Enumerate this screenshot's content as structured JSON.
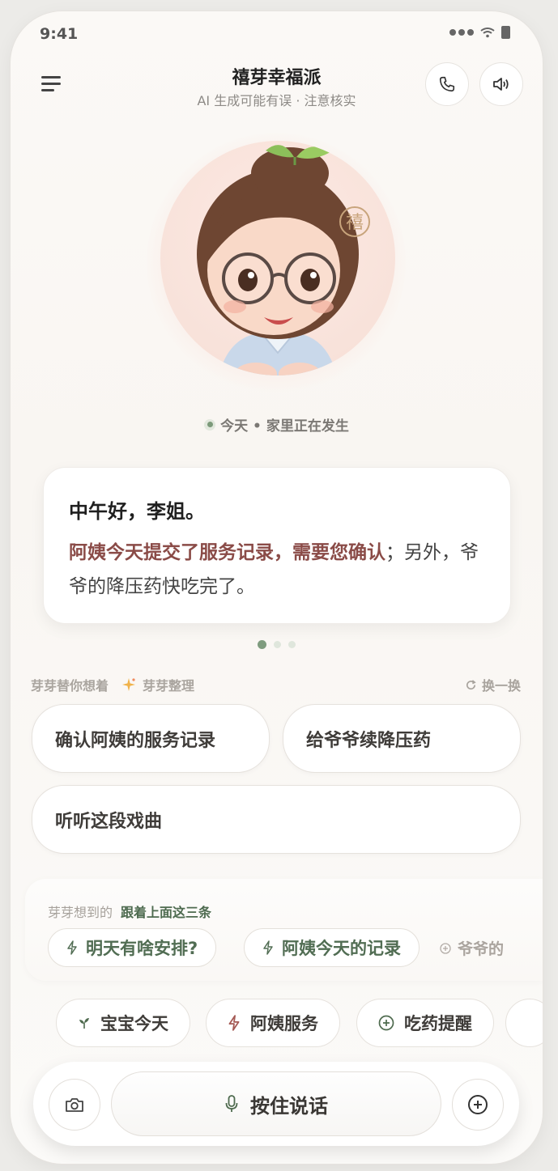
{
  "status": {
    "time": "9:41"
  },
  "header": {
    "title": "禧芽幸福派",
    "subtitle": "AI 生成可能有误 · 注意核实"
  },
  "avatar": {
    "badge_char": "禧"
  },
  "today": {
    "label": "今天 • 家里正在发生"
  },
  "greeting_card": {
    "title": "中午好，李姐。",
    "highlight": "阿姨今天提交了服务记录，需要您确认",
    "rest": "；另外，爷爷的降压药快吃完了。"
  },
  "pager": {
    "count": 3,
    "active": 1
  },
  "suggestions": {
    "head_left": "芽芽替你想着",
    "head_tag": "芽芽整理",
    "refresh": "换一换",
    "items": [
      "确认阿姨的服务记录",
      "给爷爷续降压药",
      "听听这段戏曲"
    ]
  },
  "related": {
    "label": "芽芽想到的",
    "label_strong": "跟着上面这三条",
    "chips": [
      "明天有啥安排?",
      "阿姨今天的记录",
      "爷爷的"
    ]
  },
  "quick_actions": [
    "宝宝今天",
    "阿姨服务",
    "吃药提醒"
  ],
  "input_bar": {
    "talk_label": "按住说话"
  },
  "colors": {
    "accent_green": "#7c9a7a",
    "highlight_red": "#8a4b47"
  }
}
